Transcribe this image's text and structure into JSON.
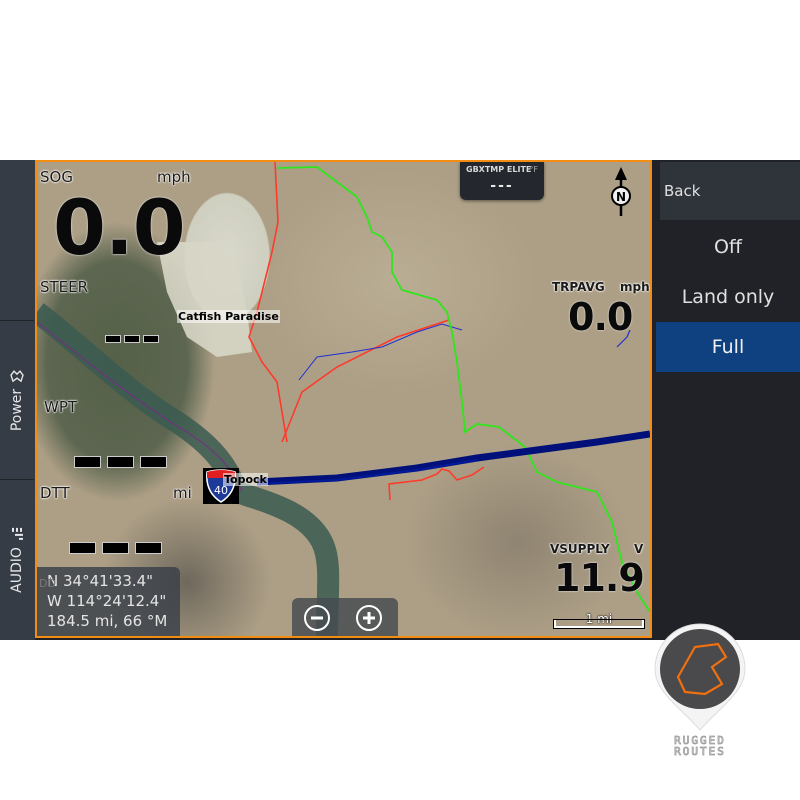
{
  "left_tabs": {
    "power": {
      "label": "Power",
      "icon": "rugged-routes-icon"
    },
    "audio": {
      "label": "AUDIO",
      "icon": "equalizer-icon"
    }
  },
  "gauges": {
    "sog": {
      "label": "SOG",
      "unit": "mph",
      "value": "0.0"
    },
    "steer": {
      "label": "STEER",
      "value": "---"
    },
    "wpt": {
      "label": "WPT",
      "value": "---"
    },
    "dtt": {
      "label": "DTT",
      "unit": "mi",
      "value": "---"
    },
    "trpavg": {
      "label": "TRPAVG",
      "unit": "mph",
      "value": "0.0"
    },
    "vsupply": {
      "label": "VSUPPLY",
      "unit": "V",
      "value": "11.9"
    },
    "temperature": {
      "label": "GBXTMP ELITE",
      "unit": "°F",
      "value": "---"
    }
  },
  "map": {
    "places": {
      "catfish": "Catfish Paradise",
      "topock": "Topock"
    },
    "interstate_shield": "40",
    "north_label": "N",
    "scale": "1 mi",
    "position": {
      "dd_label": "DD",
      "lat": "N  34°41'33.4\"",
      "lon": "W  114°24'12.4\"",
      "range_bearing": "184.5 mi, 66 °M"
    },
    "colors": {
      "highway": "#00107a",
      "green_trail": "#2ee61a",
      "red_trail": "#ff3a2a",
      "blue_trail": "#2030d0",
      "frame": "#f28c12"
    }
  },
  "menu": {
    "back": "Back",
    "items": [
      {
        "label": "Off",
        "selected": false
      },
      {
        "label": "Land only",
        "selected": false
      },
      {
        "label": "Full",
        "selected": true
      }
    ],
    "selected_color": "#0f4080"
  },
  "logo": {
    "line1": "RUGGED",
    "line2": "ROUTES"
  }
}
